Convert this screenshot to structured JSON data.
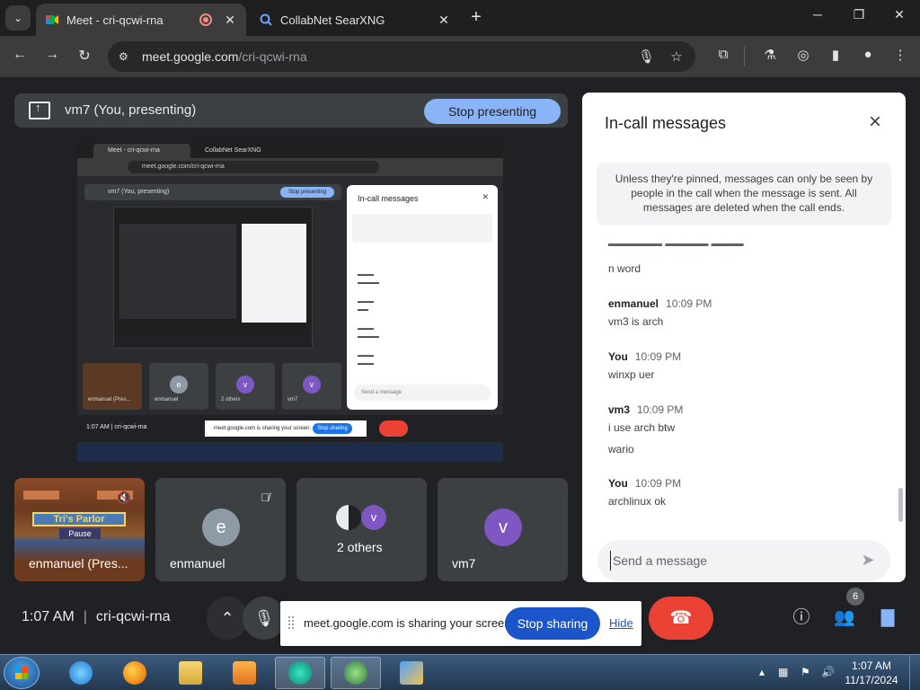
{
  "browser": {
    "tabs": [
      {
        "title": "Meet - cri-qcwi-rna",
        "active": true
      },
      {
        "title": "CollabNet SearXNG",
        "active": false
      }
    ],
    "url_host": "meet.google.com",
    "url_path": "/cri-qcwi-rna"
  },
  "meet": {
    "presenting_label": "vm7 (You, presenting)",
    "stop_presenting": "Stop presenting",
    "shared_screen": {
      "tab1": "Meet - cri-qcwi-rna",
      "tab2": "CollabNet SearXNG",
      "url": "meet.google.com/cri-qcwi-rna",
      "presenting_label": "vm7 (You, presenting)",
      "stop_presenting": "Stop presenting",
      "chat_title": "In-call messages",
      "chat_input": "Send a message",
      "tiles": [
        "enmanuel (Pres...",
        "enmanuel",
        "2 others",
        "vm7"
      ],
      "time": "1:07 AM",
      "meeting": "cri-qcwi-rna",
      "share_text": "meet.google.com is sharing your screen.",
      "stop_sharing": "Stop sharing",
      "hide": "Hide"
    },
    "tiles": [
      {
        "name": "enmanuel (Pres...",
        "game_banner": "Tri's Parlor",
        "game_pause": "Pause"
      },
      {
        "name": "enmanuel",
        "initial": "e",
        "avatar_color": "#8e9aa5"
      },
      {
        "name": "2 others",
        "initial": "v",
        "avatar_color": "#7e57c2"
      },
      {
        "name": "vm7",
        "initial": "v",
        "avatar_color": "#7e57c2"
      }
    ],
    "time": "1:07 AM",
    "meeting_code": "cri-qcwi-rna",
    "participant_count": "6"
  },
  "chat": {
    "title": "In-call messages",
    "notice": "Unless they're pinned, messages can only be seen by people in the call when the message is sent. All messages are deleted when the call ends.",
    "messages": [
      {
        "sender": "",
        "time": "",
        "lines": [
          "n word"
        ]
      },
      {
        "sender": "enmanuel",
        "time": "10:09 PM",
        "lines": [
          "vm3 is arch"
        ]
      },
      {
        "sender": "You",
        "time": "10:09 PM",
        "lines": [
          "winxp uer"
        ]
      },
      {
        "sender": "vm3",
        "time": "10:09 PM",
        "lines": [
          "i use arch btw",
          "wario"
        ]
      },
      {
        "sender": "You",
        "time": "10:09 PM",
        "lines": [
          "archlinux ok"
        ]
      }
    ],
    "input_placeholder": "Send a message"
  },
  "share_notification": {
    "text": "meet.google.com is sharing your screen.",
    "stop_sharing": "Stop sharing",
    "hide": "Hide"
  },
  "taskbar": {
    "time": "1:07 AM",
    "date": "11/17/2024"
  },
  "colors": {
    "meet_bg": "#202124",
    "accent_blue": "#8ab4f8",
    "end_call_red": "#ea4335",
    "share_blue": "#1a56c9"
  }
}
